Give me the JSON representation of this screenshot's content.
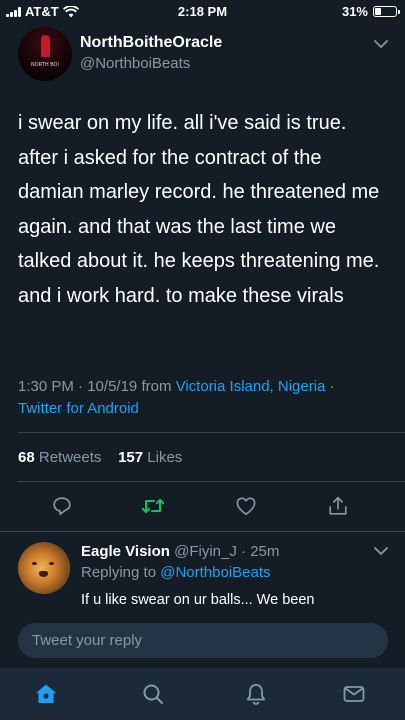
{
  "status_bar": {
    "carrier": "AT&T",
    "time": "2:18 PM",
    "battery_percent_label": "31%",
    "battery_level": 0.31
  },
  "tweet": {
    "author_name": "NorthBoitheOracle",
    "author_handle": "@NorthboiBeats",
    "avatar_text": "NORTH BOI",
    "text": "i swear on my life. all i've said is true. after i asked for the contract of the damian marley record. he threatened me again. and that was the last time we talked about it. he keeps threatening me. and i work hard. to make these virals",
    "time": "1:30 PM",
    "date": "10/5/19",
    "from_label": "from",
    "location": "Victoria Island, Nigeria",
    "client": "Twitter for Android",
    "retweets_count": "68",
    "retweets_label": "Retweets",
    "likes_count": "157",
    "likes_label": "Likes"
  },
  "reply": {
    "name": "Eagle Vision",
    "handle": "@Fiyin_J",
    "age": "25m",
    "replying_label": "Replying to",
    "replying_to": "@NorthboiBeats",
    "text": "If u like swear on ur balls... We been"
  },
  "compose": {
    "placeholder": "Tweet your reply"
  },
  "colors": {
    "background": "#141d26",
    "accent": "#1da1f2",
    "retweet_green": "#17bf63",
    "secondary_text": "#8899a6",
    "divider": "#38444d",
    "tabbar": "#1c2938"
  },
  "icons": {
    "actions": [
      "reply-icon",
      "retweet-icon",
      "like-icon",
      "share-icon"
    ],
    "tabs": [
      "home-icon",
      "search-icon",
      "notifications-icon",
      "messages-icon"
    ]
  }
}
